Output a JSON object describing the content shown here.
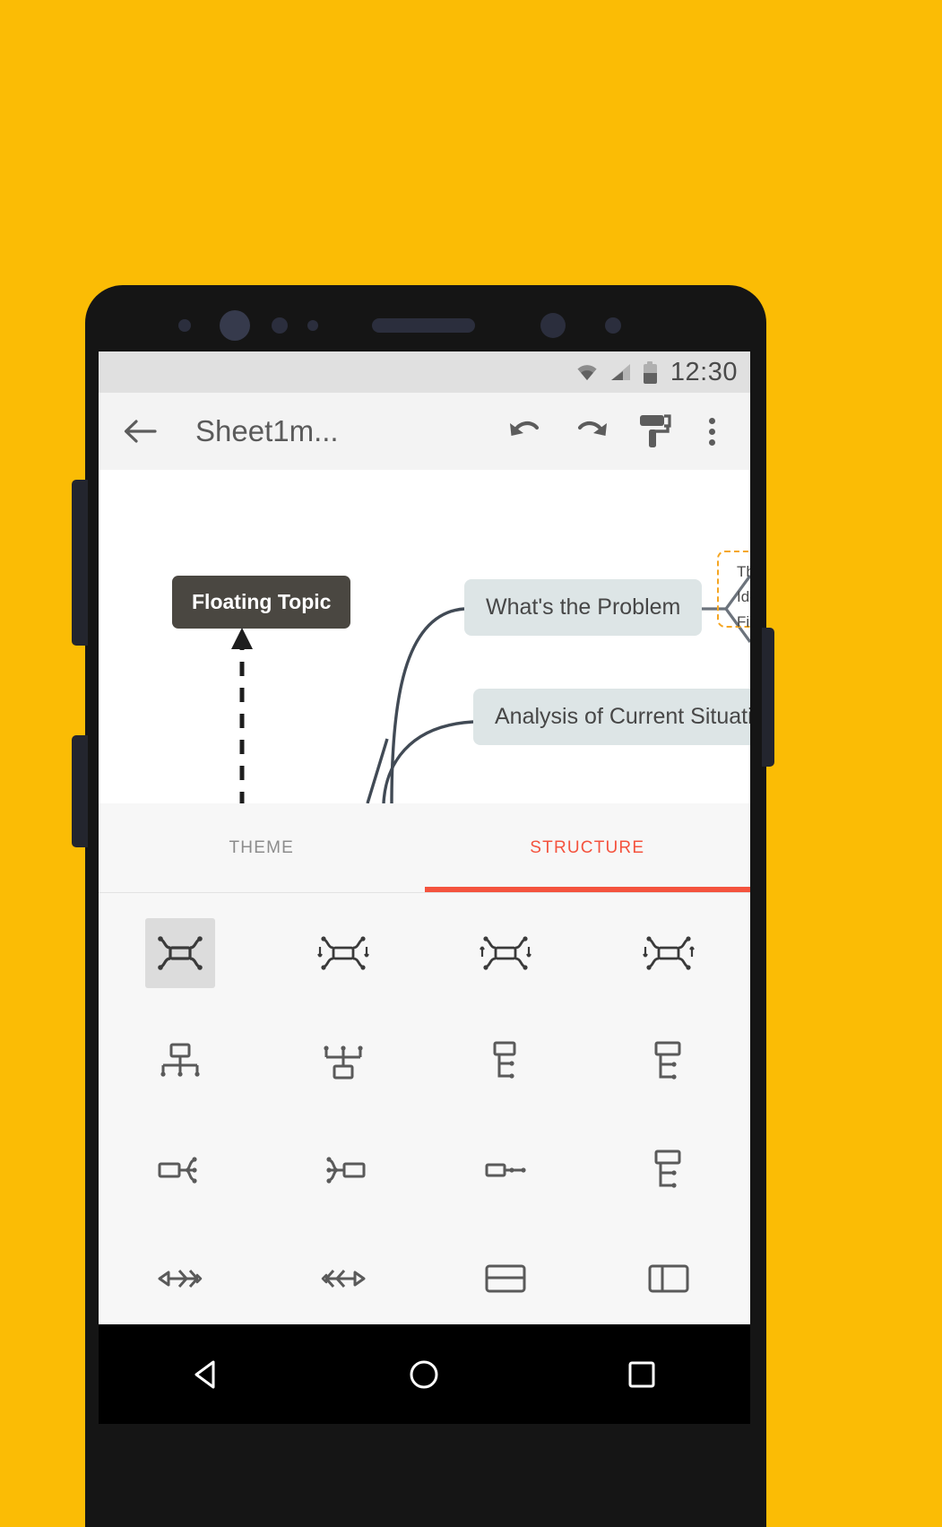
{
  "status_bar": {
    "time": "12:30",
    "icons": [
      "wifi-icon",
      "cellular-signal-icon",
      "battery-icon"
    ]
  },
  "toolbar": {
    "back_icon": "back-arrow-icon",
    "title": "Sheet1m...",
    "undo_icon": "undo-icon",
    "redo_icon": "redo-icon",
    "style_icon": "paint-roller-icon",
    "overflow_icon": "overflow-menu-icon"
  },
  "canvas": {
    "floating_topic": "Floating Topic",
    "nodes": [
      {
        "label": "What's the Problem"
      },
      {
        "label": "Analysis of Current Situation"
      }
    ],
    "sub_labels": [
      "Th",
      "Ide",
      "Fir"
    ],
    "group_outline_color": "#F5A623"
  },
  "tabs": [
    {
      "label": "THEME",
      "active": false
    },
    {
      "label": "STRUCTURE",
      "active": true
    }
  ],
  "accent_color": "#F4533E",
  "structures": [
    {
      "name": "balanced-map",
      "selected": true
    },
    {
      "name": "balanced-map-clockwise",
      "selected": false
    },
    {
      "name": "balanced-map-anticlockwise",
      "selected": false
    },
    {
      "name": "balanced-map-variant",
      "selected": false
    },
    {
      "name": "org-chart-down",
      "selected": false
    },
    {
      "name": "org-chart-up",
      "selected": false
    },
    {
      "name": "tree-chart-right-down",
      "selected": false
    },
    {
      "name": "tree-chart-down",
      "selected": false
    },
    {
      "name": "logic-chart-right",
      "selected": false
    },
    {
      "name": "logic-chart-left",
      "selected": false
    },
    {
      "name": "timeline-horizontal",
      "selected": false
    },
    {
      "name": "tree-table",
      "selected": false
    },
    {
      "name": "fishbone-left",
      "selected": false
    },
    {
      "name": "fishbone-right",
      "selected": false
    },
    {
      "name": "matrix-rows",
      "selected": false
    },
    {
      "name": "matrix-columns",
      "selected": false
    }
  ],
  "nav_bar": {
    "back": "nav-back-triangle-icon",
    "home": "nav-home-circle-icon",
    "recents": "nav-recents-square-icon"
  }
}
